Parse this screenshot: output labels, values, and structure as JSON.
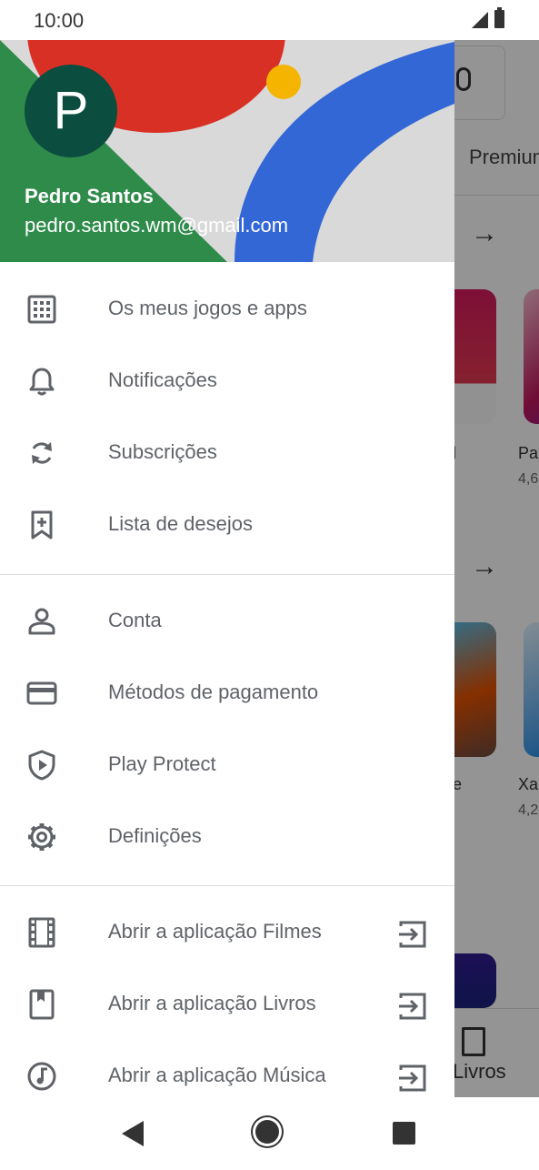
{
  "status_bar": {
    "time": "10:00"
  },
  "background_app": {
    "tab_partial": "Premium",
    "card1_title_partial": "l",
    "card2_title_partial": "Pa",
    "card2_rating_partial": "4,6",
    "card3_title_partial": "e",
    "card4_title_partial": "Xa",
    "card4_rating_partial": "4,2",
    "bottom_tab": "Livros"
  },
  "drawer": {
    "avatar_letter": "P",
    "user_name": "Pedro Santos",
    "user_email": "pedro.santos.wm@gmail.com",
    "section1": [
      {
        "label": "Os meus jogos e apps",
        "icon": "apps-grid-icon"
      },
      {
        "label": "Notificações",
        "icon": "bell-icon"
      },
      {
        "label": "Subscrições",
        "icon": "refresh-icon"
      },
      {
        "label": "Lista de desejos",
        "icon": "bookmark-add-icon"
      }
    ],
    "section2": [
      {
        "label": "Conta",
        "icon": "person-icon"
      },
      {
        "label": "Métodos de pagamento",
        "icon": "credit-card-icon"
      },
      {
        "label": "Play Protect",
        "icon": "shield-play-icon"
      },
      {
        "label": "Definições",
        "icon": "gear-icon"
      }
    ],
    "section3": [
      {
        "label": "Abrir a aplicação Filmes",
        "icon": "film-icon"
      },
      {
        "label": "Abrir a aplicação Livros",
        "icon": "book-icon"
      },
      {
        "label": "Abrir a aplicação Música",
        "icon": "music-icon"
      }
    ]
  },
  "colors": {
    "header_red": "#d93025",
    "header_blue": "#3367d6",
    "header_green": "#2e8b4a",
    "header_yellow": "#f4b400",
    "avatar_bg": "#0b4d3e",
    "icon_gray": "#5f6368"
  }
}
